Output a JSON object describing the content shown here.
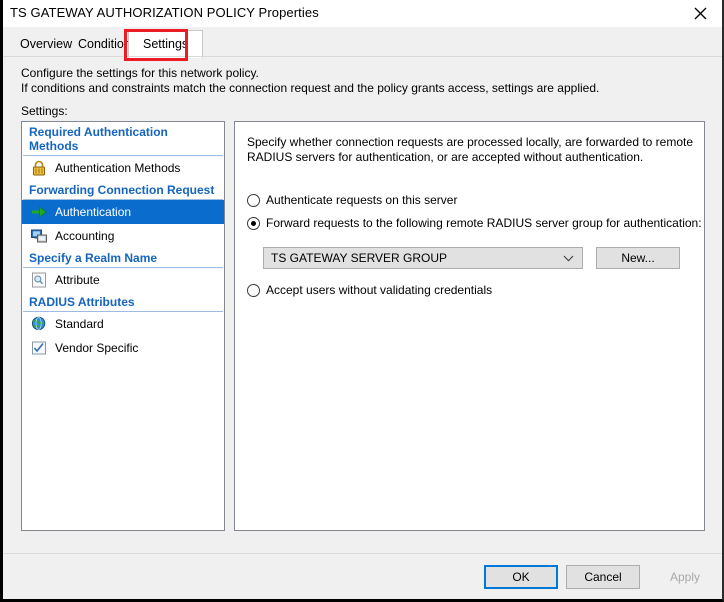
{
  "window": {
    "title": "TS GATEWAY AUTHORIZATION POLICY Properties",
    "close_label": "close-icon"
  },
  "tabs": [
    {
      "id": "overview",
      "label": "Overview",
      "selected": false
    },
    {
      "id": "conditions",
      "label": "Conditions",
      "selected": false
    },
    {
      "id": "settings",
      "label": "Settings",
      "selected": true
    }
  ],
  "page": {
    "description_line1": "Configure the settings for this network policy.",
    "description_line2": "If conditions and constraints match the connection request and the policy grants access, settings are applied.",
    "settings_label": "Settings:"
  },
  "tree": {
    "groups": [
      {
        "title": "Required Authentication Methods",
        "items": [
          {
            "label": "Authentication Methods",
            "icon": "padlock-icon",
            "selected": false
          }
        ]
      },
      {
        "title": "Forwarding Connection Request",
        "items": [
          {
            "label": "Authentication",
            "icon": "green-arrow-icon",
            "selected": true
          },
          {
            "label": "Accounting",
            "icon": "computers-icon",
            "selected": false
          }
        ]
      },
      {
        "title": "Specify a Realm Name",
        "items": [
          {
            "label": "Attribute",
            "icon": "magnifier-icon",
            "selected": false
          }
        ]
      },
      {
        "title": "RADIUS Attributes",
        "items": [
          {
            "label": "Standard",
            "icon": "globe-icon",
            "selected": false
          },
          {
            "label": "Vendor Specific",
            "icon": "checkbox-form-icon",
            "selected": false
          }
        ]
      }
    ]
  },
  "content": {
    "description_line1": "Specify whether connection requests are processed locally, are forwarded to remote",
    "description_line2": "RADIUS servers for authentication, or are accepted without authentication.",
    "radio_local": {
      "label": "Authenticate requests on this server",
      "checked": false
    },
    "radio_forward": {
      "label": "Forward requests to the following remote RADIUS server group for authentication:",
      "checked": true
    },
    "radio_accept": {
      "label": "Accept users without validating credentials",
      "checked": false
    },
    "server_group": {
      "value": "TS GATEWAY SERVER GROUP",
      "options": [
        "TS GATEWAY SERVER GROUP"
      ]
    },
    "new_button_label": "New..."
  },
  "footer": {
    "ok_label": "OK",
    "cancel_label": "Cancel",
    "apply_label": "Apply"
  },
  "colors": {
    "accent_blue": "#0078d7",
    "selection_blue": "#0a6ccd",
    "group_heading_blue": "#1565c0",
    "annotation_red": "#ec1c24"
  }
}
